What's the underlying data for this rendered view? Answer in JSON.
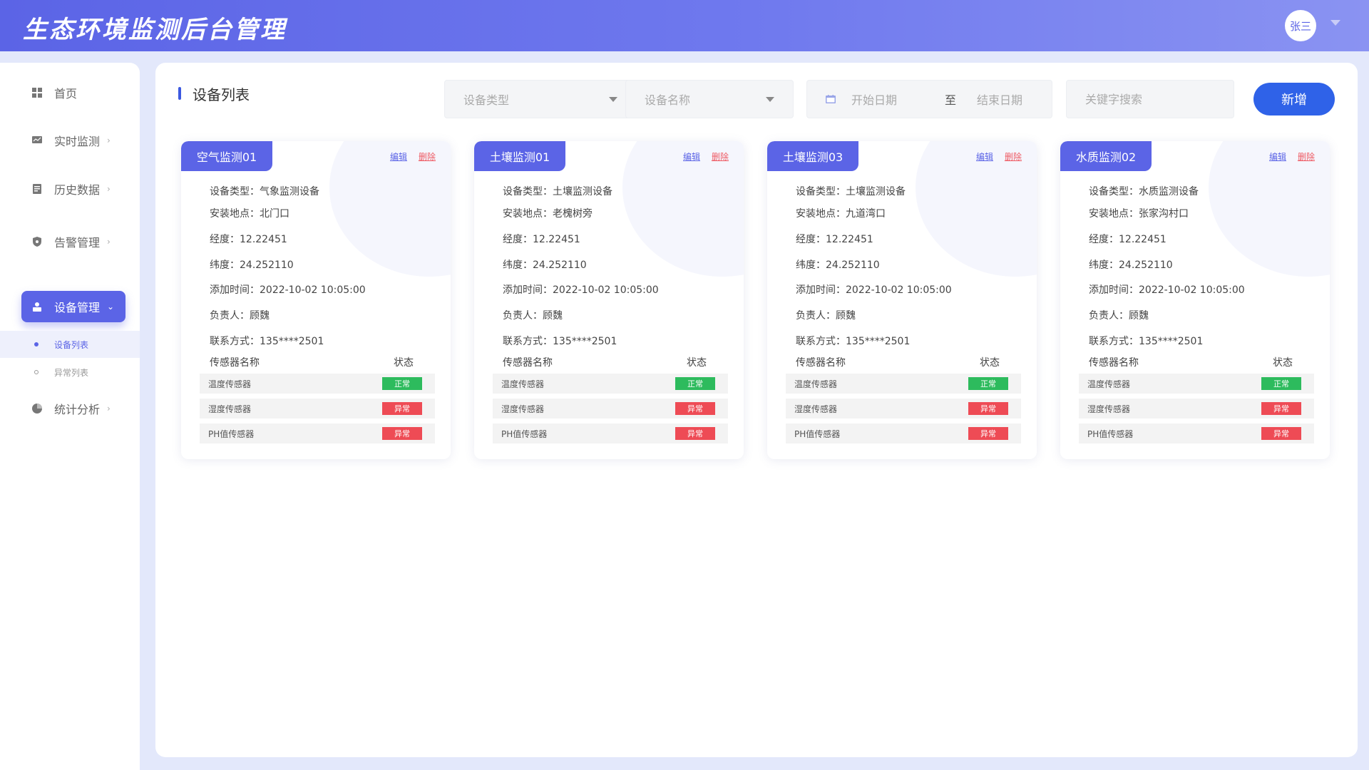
{
  "header": {
    "title": "生态环境监测后台管理",
    "user": "张三"
  },
  "sidebar": {
    "items": [
      {
        "label": "首页",
        "icon": "grid-icon",
        "has_chevron": false
      },
      {
        "label": "实时监测",
        "icon": "monitor-icon",
        "has_chevron": true
      },
      {
        "label": "历史数据",
        "icon": "document-icon",
        "has_chevron": true
      },
      {
        "label": "告警管理",
        "icon": "shield-icon",
        "has_chevron": true
      },
      {
        "label": "设备管理",
        "icon": "device-icon",
        "has_chevron": true,
        "active": true
      },
      {
        "label": "统计分析",
        "icon": "pie-chart-icon",
        "has_chevron": true
      }
    ],
    "sub_items": [
      {
        "label": "设备列表",
        "active": true
      },
      {
        "label": "异常列表",
        "active": false
      }
    ]
  },
  "main": {
    "title": "设备列表",
    "filters": {
      "device_type_placeholder": "设备类型",
      "device_name_placeholder": "设备名称",
      "start_date_placeholder": "开始日期",
      "range_separator": "至",
      "end_date_placeholder": "结束日期",
      "keyword_placeholder": "关键字搜索"
    },
    "add_label": "新增",
    "card_labels": {
      "edit": "编辑",
      "delete": "删除",
      "type": "设备类型：",
      "location": "安装地点：",
      "longitude": "经度：",
      "latitude": "纬度：",
      "added_time": "添加时间：",
      "owner": "负责人：",
      "contact": "联系方式：",
      "sensor_col": "传感器名称",
      "status_col": "状态"
    },
    "cards": [
      {
        "name": "空气监测01",
        "type": "气象监测设备",
        "location": "北门口",
        "longitude": "12.22451",
        "latitude": "24.252110",
        "added_time": "2022-10-02 10:05:00",
        "owner": "顾魏",
        "contact": "135****2501",
        "sensors": [
          {
            "name": "温度传感器",
            "status": "正常"
          },
          {
            "name": "湿度传感器",
            "status": "异常"
          },
          {
            "name": "PH值传感器",
            "status": "异常"
          }
        ]
      },
      {
        "name": "土壤监测01",
        "type": "土壤监测设备",
        "location": "老槐树旁",
        "longitude": "12.22451",
        "latitude": "24.252110",
        "added_time": "2022-10-02 10:05:00",
        "owner": "顾魏",
        "contact": "135****2501",
        "sensors": [
          {
            "name": "温度传感器",
            "status": "正常"
          },
          {
            "name": "湿度传感器",
            "status": "异常"
          },
          {
            "name": "PH值传感器",
            "status": "异常"
          }
        ]
      },
      {
        "name": "土壤监测03",
        "type": "土壤监测设备",
        "location": "九道湾口",
        "longitude": "12.22451",
        "latitude": "24.252110",
        "added_time": "2022-10-02 10:05:00",
        "owner": "顾魏",
        "contact": "135****2501",
        "sensors": [
          {
            "name": "温度传感器",
            "status": "正常"
          },
          {
            "name": "湿度传感器",
            "status": "异常"
          },
          {
            "name": "PH值传感器",
            "status": "异常"
          }
        ]
      },
      {
        "name": "水质监测02",
        "type": "水质监测设备",
        "location": "张家沟村口",
        "longitude": "12.22451",
        "latitude": "24.252110",
        "added_time": "2022-10-02 10:05:00",
        "owner": "顾魏",
        "contact": "135****2501",
        "sensors": [
          {
            "name": "温度传感器",
            "status": "正常"
          },
          {
            "name": "湿度传感器",
            "status": "异常"
          },
          {
            "name": "PH值传感器",
            "status": "异常"
          }
        ]
      }
    ]
  },
  "colors": {
    "primary": "#5b64e6",
    "button": "#2f62e8",
    "normal": "#2dbb5d",
    "abnormal": "#ee4b55"
  }
}
